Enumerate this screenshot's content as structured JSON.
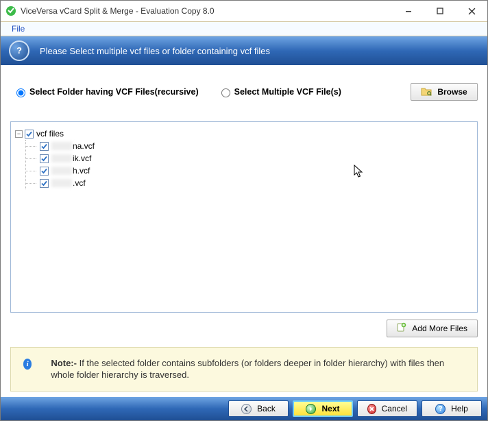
{
  "window": {
    "title": "ViceVersa vCard Split & Merge - Evaluation Copy 8.0"
  },
  "menu": {
    "file": "File"
  },
  "header": {
    "message": "Please Select multiple vcf files or folder containing vcf files"
  },
  "options": {
    "folder_label": "Select Folder having VCF Files(recursive)",
    "files_label": "Select Multiple VCF File(s)",
    "selected": "folder",
    "browse_label": "Browse"
  },
  "tree": {
    "root_label": "vcf files",
    "root_checked": true,
    "expanded": true,
    "children": [
      {
        "suffix": "na.vcf",
        "checked": true
      },
      {
        "suffix": "ik.vcf",
        "checked": true
      },
      {
        "suffix": "h.vcf",
        "checked": true
      },
      {
        "suffix": ".vcf",
        "checked": true
      }
    ]
  },
  "add_more_label": "Add More Files",
  "note": {
    "prefix": "Note:- ",
    "body": "If the selected folder contains subfolders (or folders deeper in folder hierarchy) with files then whole folder hierarchy is traversed."
  },
  "footer": {
    "back": "Back",
    "next": "Next",
    "cancel": "Cancel",
    "help": "Help"
  }
}
